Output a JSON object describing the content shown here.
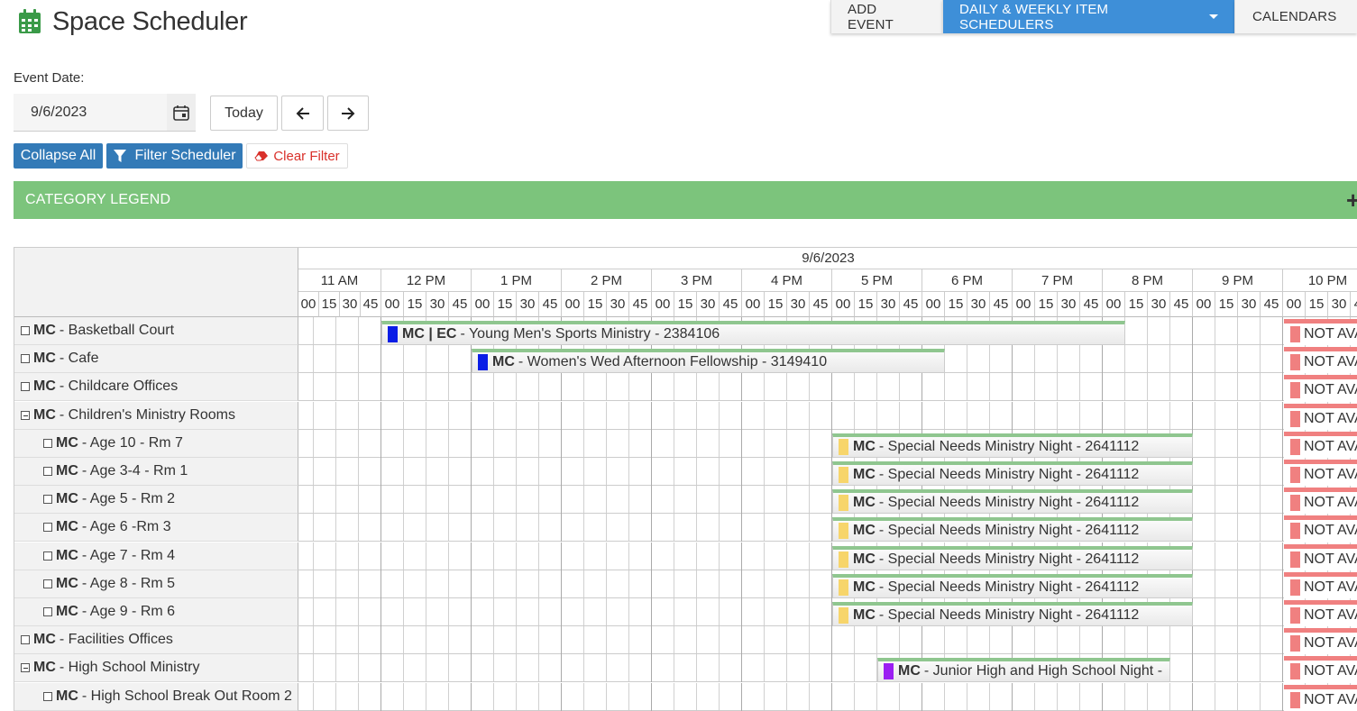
{
  "app": {
    "title": "Space Scheduler",
    "icon": "calendar-icon"
  },
  "topnav": {
    "add_event": "ADD EVENT",
    "daily_weekly": "DAILY & WEEKLY ITEM SCHEDULERS",
    "calendars": "CALENDARS"
  },
  "event_date": {
    "label": "Event Date:",
    "value": "9/6/2023"
  },
  "buttons": {
    "today": "Today",
    "collapse_all": "Collapse All",
    "filter_scheduler": "Filter Scheduler",
    "clear_filter": "Clear Filter"
  },
  "legend": {
    "label": "CATEGORY LEGEND"
  },
  "scheduler": {
    "date": "9/6/2023",
    "hours": [
      "11 AM",
      "12 PM",
      "1 PM",
      "2 PM",
      "3 PM",
      "4 PM",
      "5 PM",
      "6 PM",
      "7 PM",
      "8 PM",
      "9 PM",
      "10 PM"
    ],
    "minutes": [
      "00",
      "15",
      "30",
      "45"
    ],
    "not_available": "NOT AVAILABLE",
    "rows": [
      {
        "prefix": "MC",
        "name": "- Basketball Court",
        "indent": 0,
        "toggle": "plus"
      },
      {
        "prefix": "MC",
        "name": "- Cafe",
        "indent": 0,
        "toggle": "plus"
      },
      {
        "prefix": "MC",
        "name": "- Childcare Offices",
        "indent": 0,
        "toggle": "plus"
      },
      {
        "prefix": "MC",
        "name": "- Children's Ministry Rooms",
        "indent": 0,
        "toggle": "minus"
      },
      {
        "prefix": "MC",
        "name": "- Age 10 - Rm 7",
        "indent": 1,
        "toggle": "plus"
      },
      {
        "prefix": "MC",
        "name": "- Age 3-4 - Rm 1",
        "indent": 1,
        "toggle": "plus"
      },
      {
        "prefix": "MC",
        "name": "- Age 5 - Rm 2",
        "indent": 1,
        "toggle": "plus"
      },
      {
        "prefix": "MC",
        "name": "- Age 6 -Rm 3",
        "indent": 1,
        "toggle": "plus"
      },
      {
        "prefix": "MC",
        "name": "- Age 7 - Rm 4",
        "indent": 1,
        "toggle": "plus"
      },
      {
        "prefix": "MC",
        "name": "- Age 8 - Rm 5",
        "indent": 1,
        "toggle": "plus"
      },
      {
        "prefix": "MC",
        "name": "- Age 9 - Rm 6",
        "indent": 1,
        "toggle": "plus"
      },
      {
        "prefix": "MC",
        "name": "- Facilities Offices",
        "indent": 0,
        "toggle": "plus"
      },
      {
        "prefix": "MC",
        "name": "- High School Ministry",
        "indent": 0,
        "toggle": "minus"
      },
      {
        "prefix": "MC",
        "name": "- High School Break Out Room 2",
        "indent": 1,
        "toggle": "plus"
      }
    ],
    "events": [
      {
        "row": 0,
        "start": "12:00",
        "end": "20:15",
        "prefix": "MC | EC",
        "title": "- Young Men's Sports Ministry - 2384106",
        "color": "#0a1de6",
        "tip": true
      },
      {
        "row": 1,
        "start": "13:00",
        "end": "18:15",
        "prefix": "MC",
        "title": "- Women's Wed Afternoon Fellowship - 3149410",
        "color": "#0a1de6",
        "tip": false
      },
      {
        "row": 4,
        "start": "17:00",
        "end": "21:00",
        "prefix": "MC",
        "title": "- Special Needs Ministry Night - 2641112",
        "color": "#f7d56b",
        "tip": false
      },
      {
        "row": 5,
        "start": "17:00",
        "end": "21:00",
        "prefix": "MC",
        "title": "- Special Needs Ministry Night - 2641112",
        "color": "#f7d56b",
        "tip": false
      },
      {
        "row": 6,
        "start": "17:00",
        "end": "21:00",
        "prefix": "MC",
        "title": "- Special Needs Ministry Night - 2641112",
        "color": "#f7d56b",
        "tip": false
      },
      {
        "row": 7,
        "start": "17:00",
        "end": "21:00",
        "prefix": "MC",
        "title": "- Special Needs Ministry Night - 2641112",
        "color": "#f7d56b",
        "tip": false
      },
      {
        "row": 8,
        "start": "17:00",
        "end": "21:00",
        "prefix": "MC",
        "title": "- Special Needs Ministry Night - 2641112",
        "color": "#f7d56b",
        "tip": false
      },
      {
        "row": 9,
        "start": "17:00",
        "end": "21:00",
        "prefix": "MC",
        "title": "- Special Needs Ministry Night - 2641112",
        "color": "#f7d56b",
        "tip": false
      },
      {
        "row": 10,
        "start": "17:00",
        "end": "21:00",
        "prefix": "MC",
        "title": "- Special Needs Ministry Night - 2641112",
        "color": "#f7d56b",
        "tip": false
      },
      {
        "row": 12,
        "start": "17:30",
        "end": "20:45",
        "prefix": "MC",
        "title": "- Junior High and High School Night -",
        "color": "#9b1ff2",
        "tip": true
      }
    ]
  }
}
